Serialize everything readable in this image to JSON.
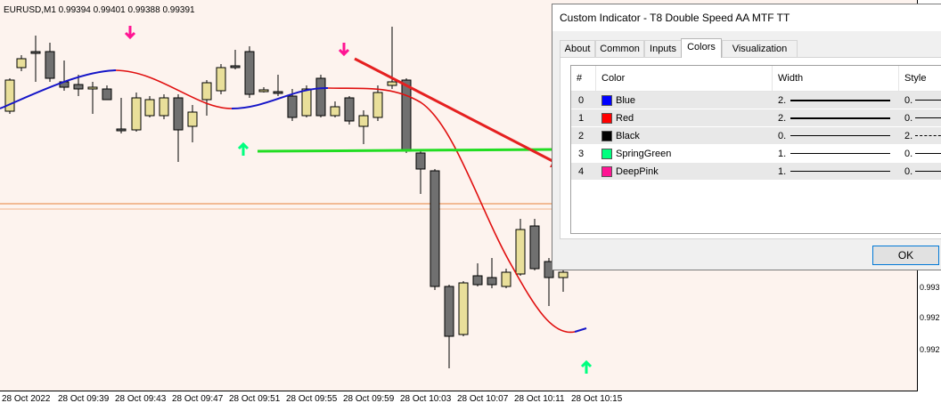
{
  "chart": {
    "symbol_info": "EURUSD,M1  0.99394 0.99401 0.99388 0.99391",
    "price_labels": [
      "0.993",
      "0.992",
      "0.992"
    ],
    "time_labels": [
      "28 Oct 2022",
      "28 Oct 09:39",
      "28 Oct 09:43",
      "28 Oct 09:47",
      "28 Oct 09:51",
      "28 Oct 09:55",
      "28 Oct 09:59",
      "28 Oct 10:03",
      "28 Oct 10:07",
      "28 Oct 10:11",
      "28 Oct 10:15"
    ],
    "colors": {
      "background": "#fdf3ee",
      "bull_candle": "#e9df9a",
      "bear_candle": "#707070",
      "up_line": "#0000ff",
      "down_line": "#ff0000",
      "arrow_up": "#00ff7f",
      "arrow_down": "#ff1493",
      "annotation_red": "#e52020",
      "annotation_green": "#22dd22",
      "level_line": "#e8813a"
    },
    "icons": {
      "up_arrow": "arrow-up-icon",
      "down_arrow": "arrow-down-icon"
    }
  },
  "dialog": {
    "title": "Custom Indicator - T8 Double Speed AA MTF TT",
    "tabs": [
      "About",
      "Common",
      "Inputs",
      "Colors",
      "Visualization"
    ],
    "active_tab": "Colors",
    "table": {
      "headers": [
        "#",
        "Color",
        "Width",
        "Style"
      ],
      "rows": [
        {
          "index": "0",
          "color_name": "Blue",
          "swatch": "#0000ff",
          "width": "2.",
          "style": "0."
        },
        {
          "index": "1",
          "color_name": "Red",
          "swatch": "#ff0000",
          "width": "2.",
          "style": "0."
        },
        {
          "index": "2",
          "color_name": "Black",
          "swatch": "#000000",
          "width": "0.",
          "style": "2."
        },
        {
          "index": "3",
          "color_name": "SpringGreen",
          "swatch": "#00ff7f",
          "width": "1.",
          "style": "0."
        },
        {
          "index": "4",
          "color_name": "DeepPink",
          "swatch": "#ff1493",
          "width": "1.",
          "style": "0."
        }
      ]
    },
    "ok_label": "OK"
  }
}
